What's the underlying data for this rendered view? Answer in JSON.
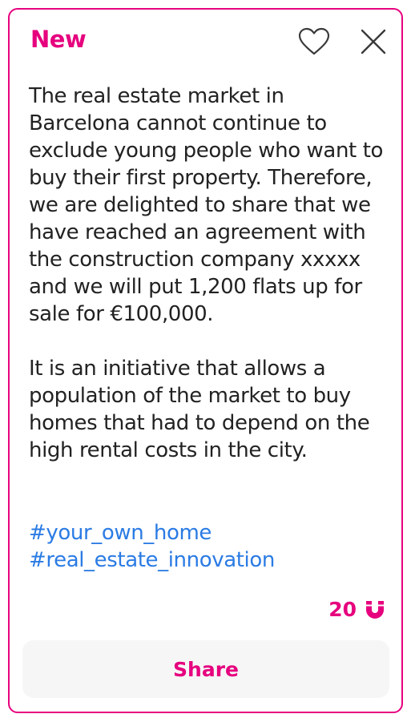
{
  "card": {
    "badge": "New",
    "icons": {
      "favorite": "heart-icon",
      "close": "close-icon"
    },
    "paragraphs": [
      "The real estate market in Barcelona cannot continue to exclude young people who want to buy their first property. Therefore, we are delighted to share that we have reached an agreement with the construction company xxxxx and we will put 1,200 flats up for sale for €100,000.",
      "It is an initiative that allows a population of the market to buy homes that had to depend on the high rental costs in the city."
    ],
    "hashtags": [
      "#your_own_home",
      "#real_estate_innovation"
    ],
    "points": {
      "value": "20",
      "icon": "magnet-icon"
    },
    "share_label": "Share"
  },
  "colors": {
    "accent": "#e6007e",
    "hashtag": "#2b7be4",
    "text": "#222222",
    "button_bg": "#f6f6f6"
  }
}
